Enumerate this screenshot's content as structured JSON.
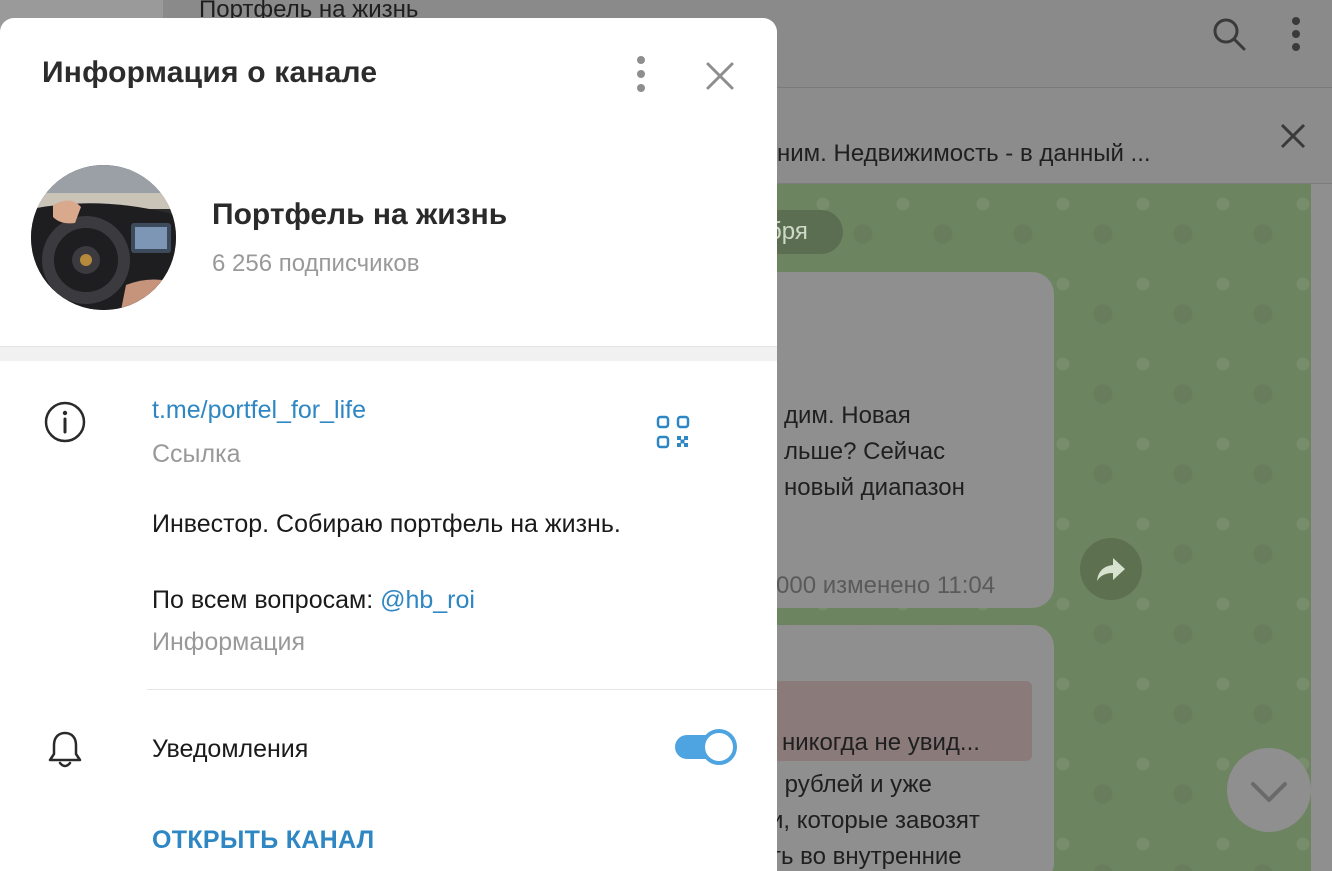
{
  "background": {
    "header_title": "Портфель на жизнь",
    "pinned_text": "ним.   Недвижимость - в данный ...",
    "date_pill": "бря",
    "bubble1_lines": [
      "дим. Новая",
      "льше? Сейчас",
      " новый диапазон"
    ],
    "bubble1_meta": "000   изменено 11:04",
    "bubble2_quote": "е никогда не увид...",
    "bubble2_lines": [
      ") рублей и уже",
      "и, которые завозят",
      "ть во внутренние"
    ]
  },
  "modal": {
    "title": "Информация о канале",
    "channel_name": "Портфель на жизнь",
    "subscribers": "6 256 подписчиков",
    "link": "t.me/portfel_for_life",
    "link_label": "Ссылка",
    "description_line1": "Инвестор. Собираю портфель на жизнь.",
    "description_line2_prefix": "По всем вопросам: ",
    "description_mention": "@hb_roi",
    "info_label": "Информация",
    "notifications_label": "Уведомления",
    "notifications_enabled": true,
    "open_channel": "ОТКРЫТЬ КАНАЛ"
  },
  "colors": {
    "accent": "#2e87c3",
    "toggle": "#4ea4e0",
    "muted": "#999999"
  },
  "icons": [
    "search-icon",
    "more-vertical-icon",
    "close-icon",
    "info-icon",
    "qr-code-icon",
    "bell-icon",
    "forward-icon",
    "chevron-down-icon"
  ]
}
